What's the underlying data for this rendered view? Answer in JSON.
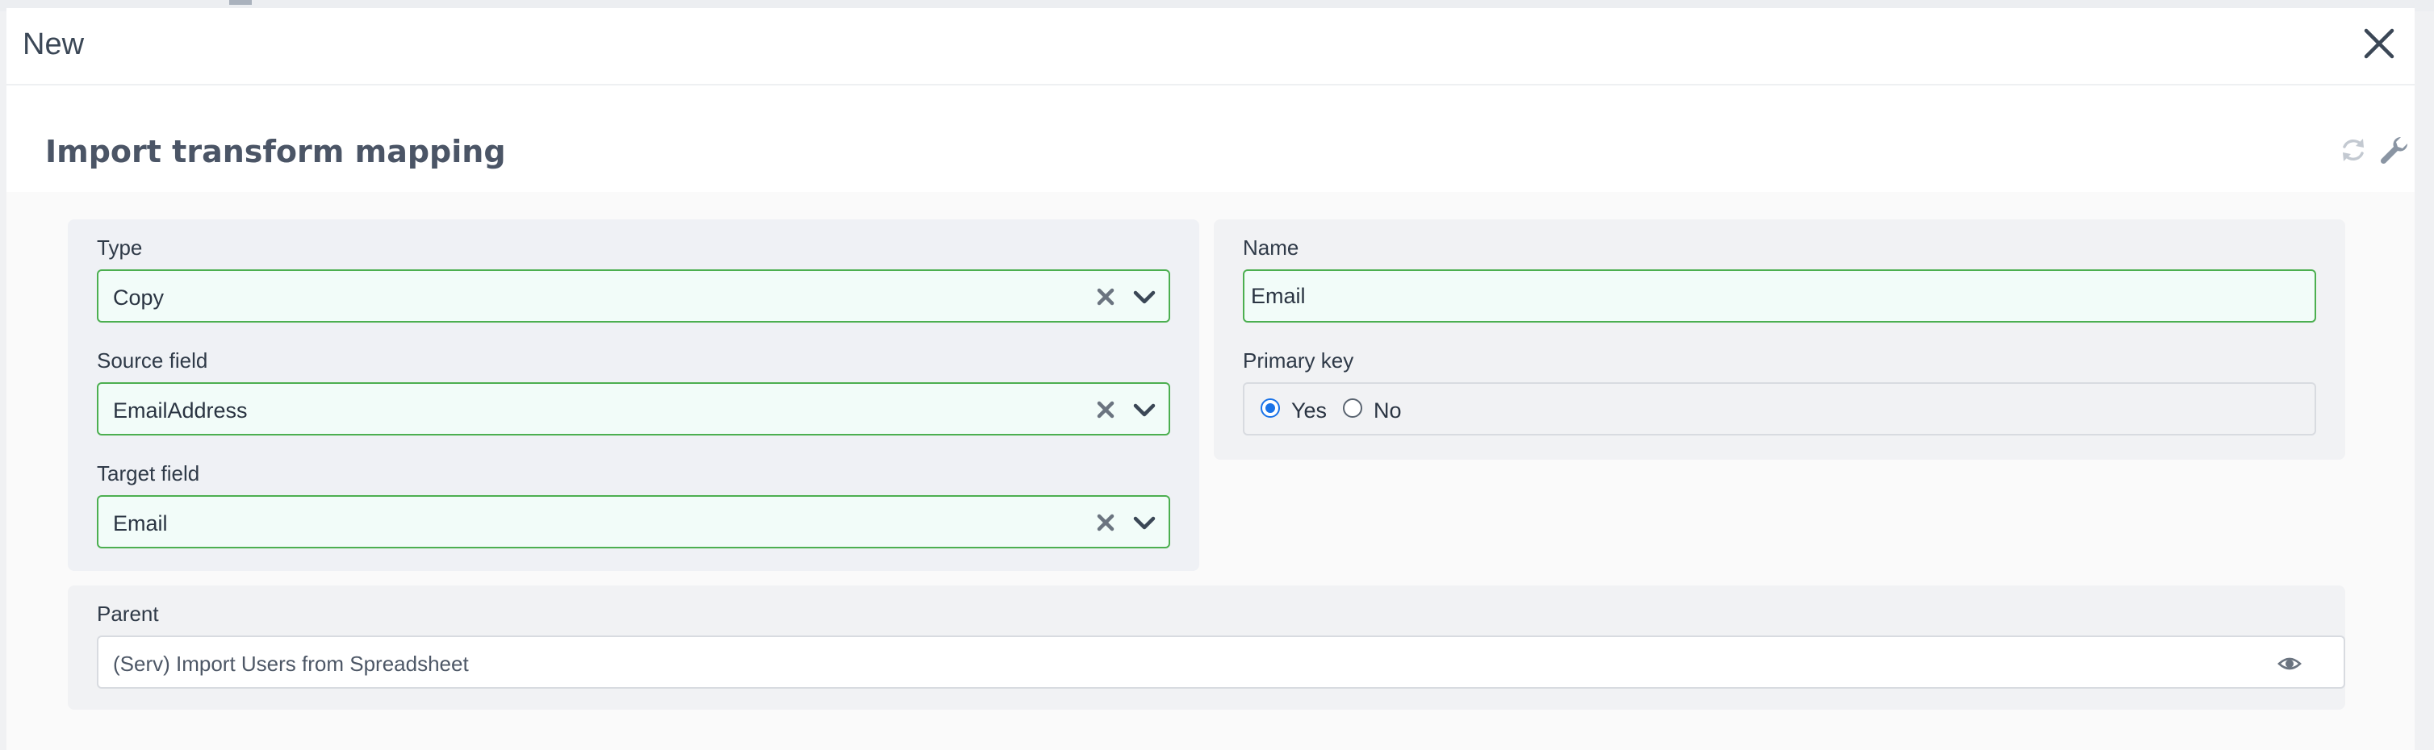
{
  "modal": {
    "title": "New",
    "close_icon": "close-icon"
  },
  "form": {
    "title": "Import transform mapping",
    "toolbar_icons": [
      "refresh-icon",
      "wrench-icon"
    ]
  },
  "fields": {
    "type": {
      "label": "Type",
      "value": "Copy"
    },
    "source_field": {
      "label": "Source field",
      "value": "EmailAddress"
    },
    "target_field": {
      "label": "Target field",
      "value": "Email"
    },
    "name": {
      "label": "Name",
      "value": "Email"
    },
    "primary_key": {
      "label": "Primary key",
      "options": [
        {
          "label": "Yes",
          "checked": true
        },
        {
          "label": "No",
          "checked": false
        }
      ]
    },
    "parent": {
      "label": "Parent",
      "value": "(Serv) Import Users from Spreadsheet"
    }
  },
  "colors": {
    "valid_border": "#4caf50",
    "valid_background": "#f2fcf9",
    "radio_accent": "#1a73e8",
    "title_text": "#4b5566"
  }
}
